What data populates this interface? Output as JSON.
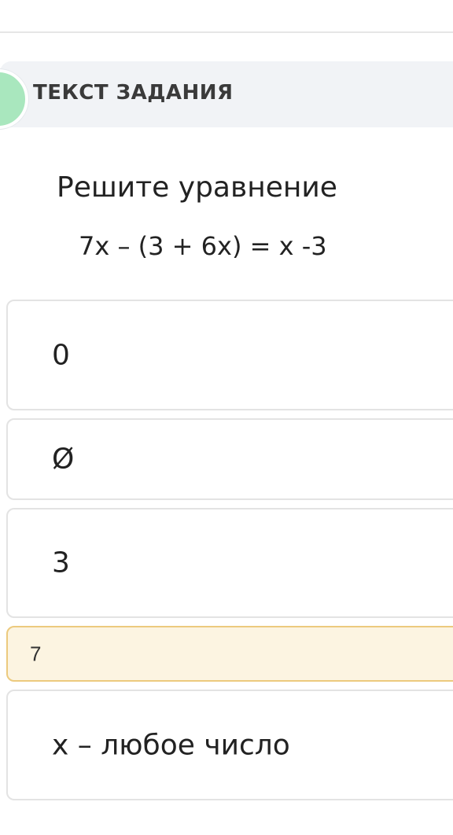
{
  "task": {
    "header_label": "ТЕКСТ ЗАДАНИЯ",
    "question": "Решите уравнение",
    "equation": "7x – (3 + 6x) = x -3"
  },
  "answers": [
    {
      "label": "0",
      "selected": false
    },
    {
      "label": "Ø",
      "selected": false
    },
    {
      "label": "3",
      "selected": false
    },
    {
      "label": "7",
      "selected": true
    },
    {
      "label": "x – любое число",
      "selected": false
    }
  ],
  "colors": {
    "header_background": "#f1f3f6",
    "step_marker": "#a9e7be",
    "option_border": "#e3e3e3",
    "selected_background": "#fcf4e1",
    "selected_border": "#ecca7e"
  }
}
